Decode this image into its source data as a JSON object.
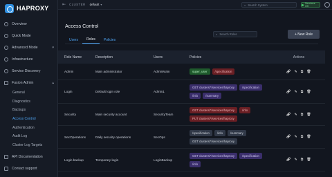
{
  "app": {
    "name": "HAPROXY"
  },
  "sidebar": {
    "items": [
      {
        "label": "Overview"
      },
      {
        "label": "Quick Mode"
      },
      {
        "label": "Advanced Mode"
      },
      {
        "label": "Infrastructure"
      },
      {
        "label": "Service Discovery"
      },
      {
        "label": "Fusion Admin"
      }
    ],
    "subitems": [
      {
        "label": "General"
      },
      {
        "label": "Diagnostics"
      },
      {
        "label": "Backups"
      },
      {
        "label": "Access Control"
      },
      {
        "label": "Authentication"
      },
      {
        "label": "Audit Log"
      },
      {
        "label": "Cluster Log Targets"
      }
    ],
    "bottom": [
      {
        "label": "API Documentation"
      },
      {
        "label": "Contact support"
      }
    ]
  },
  "topbar": {
    "cluster_label": "CLUSTER",
    "cluster_value": "default",
    "search_placeholder": "Search System",
    "status": "Services OK"
  },
  "page": {
    "title": "Access Control",
    "tabs": [
      "Users",
      "Roles",
      "Policies"
    ],
    "search_placeholder": "Search Roles",
    "new_role_label": "+ New Role"
  },
  "table": {
    "headers": [
      "Role Name",
      "Description",
      "Users",
      "Policies",
      "Actions"
    ],
    "rows": [
      {
        "name": "Admin",
        "description": "Main administrator",
        "users": "AdminMain",
        "policies": [
          {
            "label": "super_user",
            "color": "green"
          },
          {
            "label": "/specification",
            "color": "red"
          }
        ]
      },
      {
        "name": "Login",
        "description": "Default login role",
        "users": "Admin1",
        "policies": [
          {
            "label": "GET clusters/*/services/haproxy",
            "color": "purple"
          },
          {
            "label": "/specification",
            "color": "purple"
          },
          {
            "label": "/info",
            "color": "purple"
          },
          {
            "label": "/summary",
            "color": "purple"
          }
        ]
      },
      {
        "name": "Security",
        "description": "Main security account",
        "users": "SecurityTeam",
        "policies": [
          {
            "label": "GET clusters/*/services/haproxy",
            "color": "red"
          },
          {
            "label": "/info",
            "color": "red"
          },
          {
            "label": "PUT clusters/*/services/haproxy",
            "color": "red"
          }
        ]
      },
      {
        "name": "SecOperations",
        "description": "Daily security operations",
        "users": "SecOps",
        "policies": [
          {
            "label": "/specification",
            "color": "gray"
          },
          {
            "label": "/info",
            "color": "gray"
          },
          {
            "label": "/summary",
            "color": "gray"
          },
          {
            "label": "GET clusters/*/services/haproxy",
            "color": "gray"
          }
        ]
      },
      {
        "name": "Login backup",
        "description": "Temporary login",
        "users": "LoginBackup",
        "policies": [
          {
            "label": "GET clusters/*/services/haproxy",
            "color": "purple"
          },
          {
            "label": "/specification",
            "color": "purple"
          },
          {
            "label": "/info",
            "color": "purple"
          }
        ]
      }
    ]
  },
  "colors": {
    "accent": "#4ea4f2",
    "background": "#12161f",
    "sidebar": "#161b25"
  }
}
